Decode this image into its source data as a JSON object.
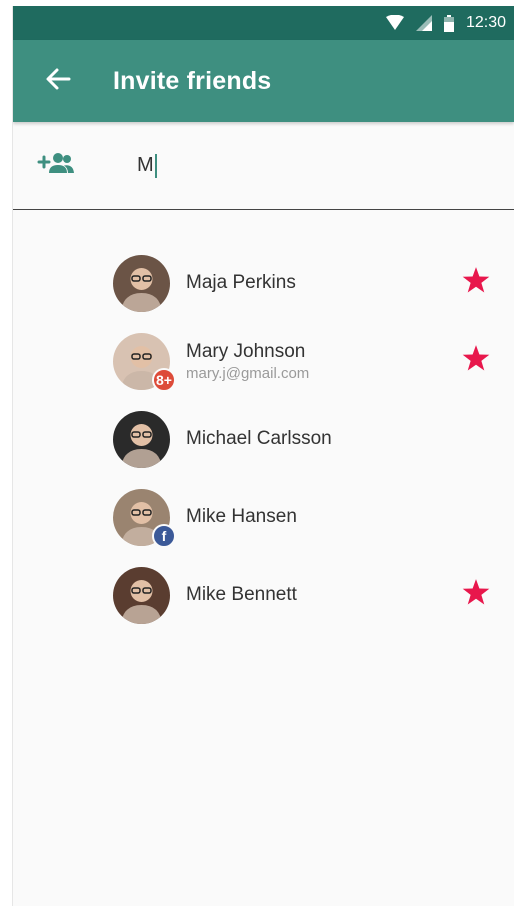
{
  "status_bar": {
    "time": "12:30"
  },
  "app_bar": {
    "title": "Invite friends"
  },
  "search": {
    "value": "M"
  },
  "colors": {
    "primary": "#3e8f80",
    "primary_dark": "#1f6b5f",
    "star": "#e8174c",
    "google": "#dd4b39",
    "facebook": "#3b5998"
  },
  "contacts": [
    {
      "name": "Maja Perkins",
      "subtitle": "",
      "starred": true,
      "badge": "",
      "avatar_tone": "#6b5446"
    },
    {
      "name": "Mary Johnson",
      "subtitle": "mary.j@gmail.com",
      "starred": true,
      "badge": "google",
      "badge_text": "8+",
      "avatar_tone": "#d8c2b2"
    },
    {
      "name": "Michael Carlsson",
      "subtitle": "",
      "starred": false,
      "badge": "",
      "avatar_tone": "#2a2a2a"
    },
    {
      "name": "Mike Hansen",
      "subtitle": "",
      "starred": false,
      "badge": "facebook",
      "badge_text": "f",
      "avatar_tone": "#9a8470"
    },
    {
      "name": "Mike Bennett",
      "subtitle": "",
      "starred": true,
      "badge": "",
      "avatar_tone": "#5a3d30"
    }
  ]
}
